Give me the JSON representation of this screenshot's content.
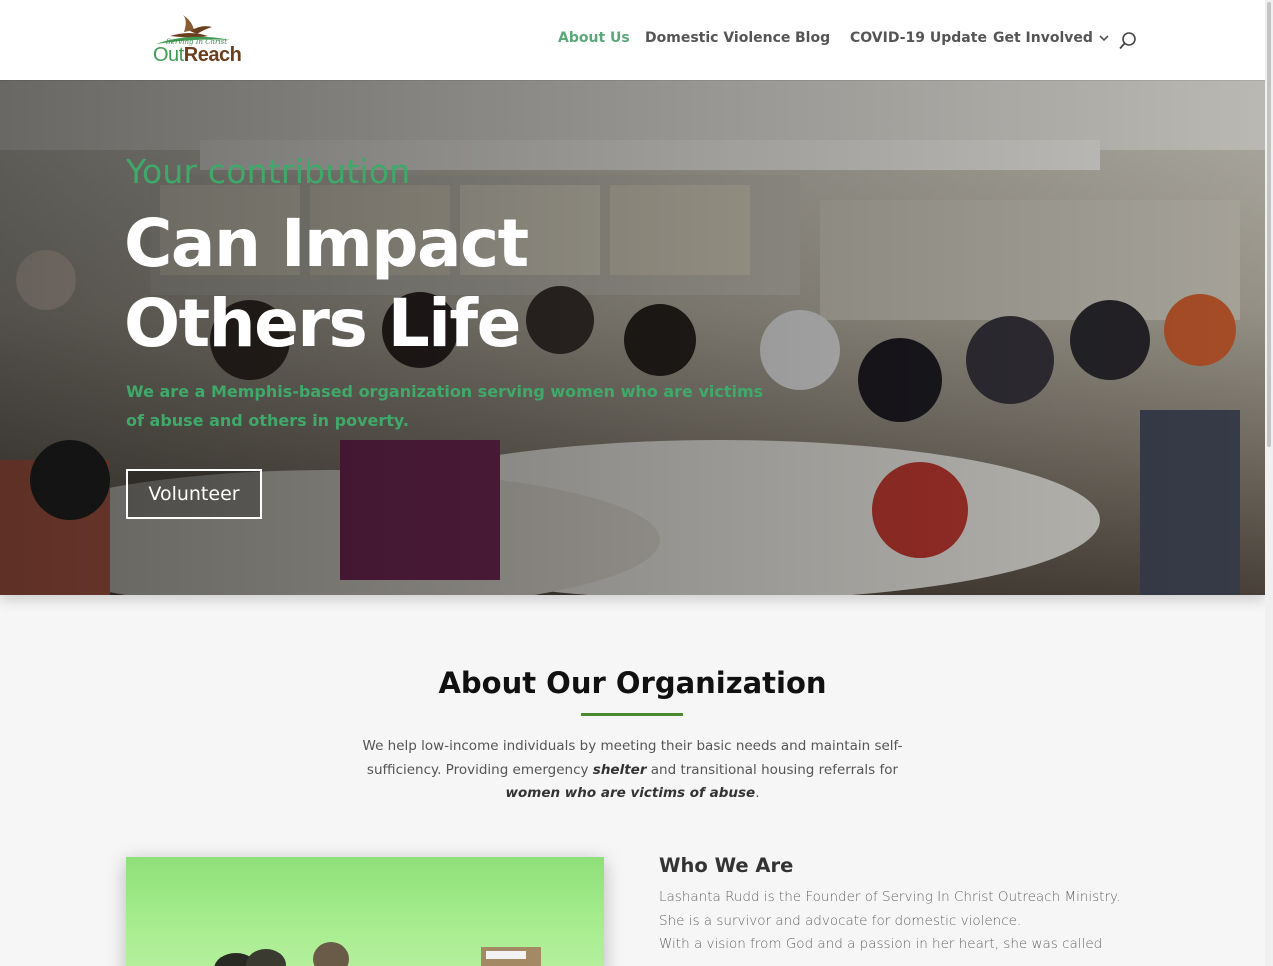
{
  "header": {
    "logo_tagline": "Serving In Christ",
    "logo_word_1": "Out",
    "logo_word_2": "Reach",
    "nav": [
      {
        "label": "About Us",
        "active": true
      },
      {
        "label": "Domestic Violence"
      },
      {
        "label": "Blog"
      },
      {
        "label": "COVID-19 Update"
      },
      {
        "label": "Get Involved",
        "has_dropdown": true
      }
    ],
    "search_icon": "search-icon",
    "colors": {
      "active": "#5aa97a",
      "brand_green": "#3e9b51",
      "brand_brown": "#6b3f1e"
    }
  },
  "hero": {
    "kicker": "Your contribution",
    "title_line_1": "Can Impact",
    "title_line_2": "Others Life",
    "subtitle": "We are a Memphis-based organization serving women who are victims of abuse and others in poverty.",
    "button": "Volunteer",
    "colors": {
      "accent": "#3fa96a"
    }
  },
  "about": {
    "title": "About Our Organization",
    "text_1": "We help low-income individuals by meeting their basic needs and maintain self-sufficiency. Providing emergency ",
    "emph_1": "shelter",
    "text_2": " and transitional housing referrals for ",
    "emph_2": "women who are victims of abuse",
    "text_3": ".",
    "underline_color": "#4a8a2e"
  },
  "who": {
    "title": "Who We Are",
    "paragraph_1": "Lashanta Rudd is the Founder of Serving In Christ Outreach Ministry. She is a survivor and advocate for domestic violence.",
    "paragraph_2": "With a vision from God and a passion in her heart, she was called"
  }
}
